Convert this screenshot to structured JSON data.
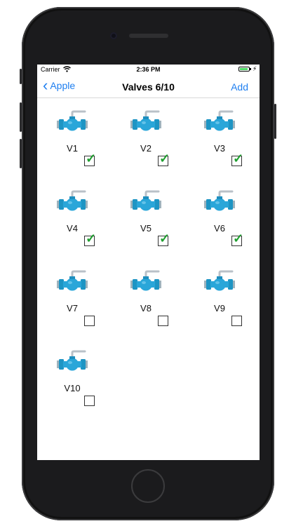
{
  "status_bar": {
    "carrier": "Carrier",
    "time": "2:36 PM",
    "battery_level": 0.9
  },
  "nav": {
    "back_label": "Apple",
    "title": "Valves 6/10",
    "add_label": "Add"
  },
  "icons": {
    "back": "chevron-left-icon",
    "wifi": "wifi-icon",
    "valve": "valve-icon",
    "battery": "battery-icon"
  },
  "valves": [
    {
      "label": "V1",
      "checked": true
    },
    {
      "label": "V2",
      "checked": true
    },
    {
      "label": "V3",
      "checked": true
    },
    {
      "label": "V4",
      "checked": true
    },
    {
      "label": "V5",
      "checked": true
    },
    {
      "label": "V6",
      "checked": true
    },
    {
      "label": "V7",
      "checked": false
    },
    {
      "label": "V8",
      "checked": false
    },
    {
      "label": "V9",
      "checked": false
    },
    {
      "label": "V10",
      "checked": false
    }
  ]
}
